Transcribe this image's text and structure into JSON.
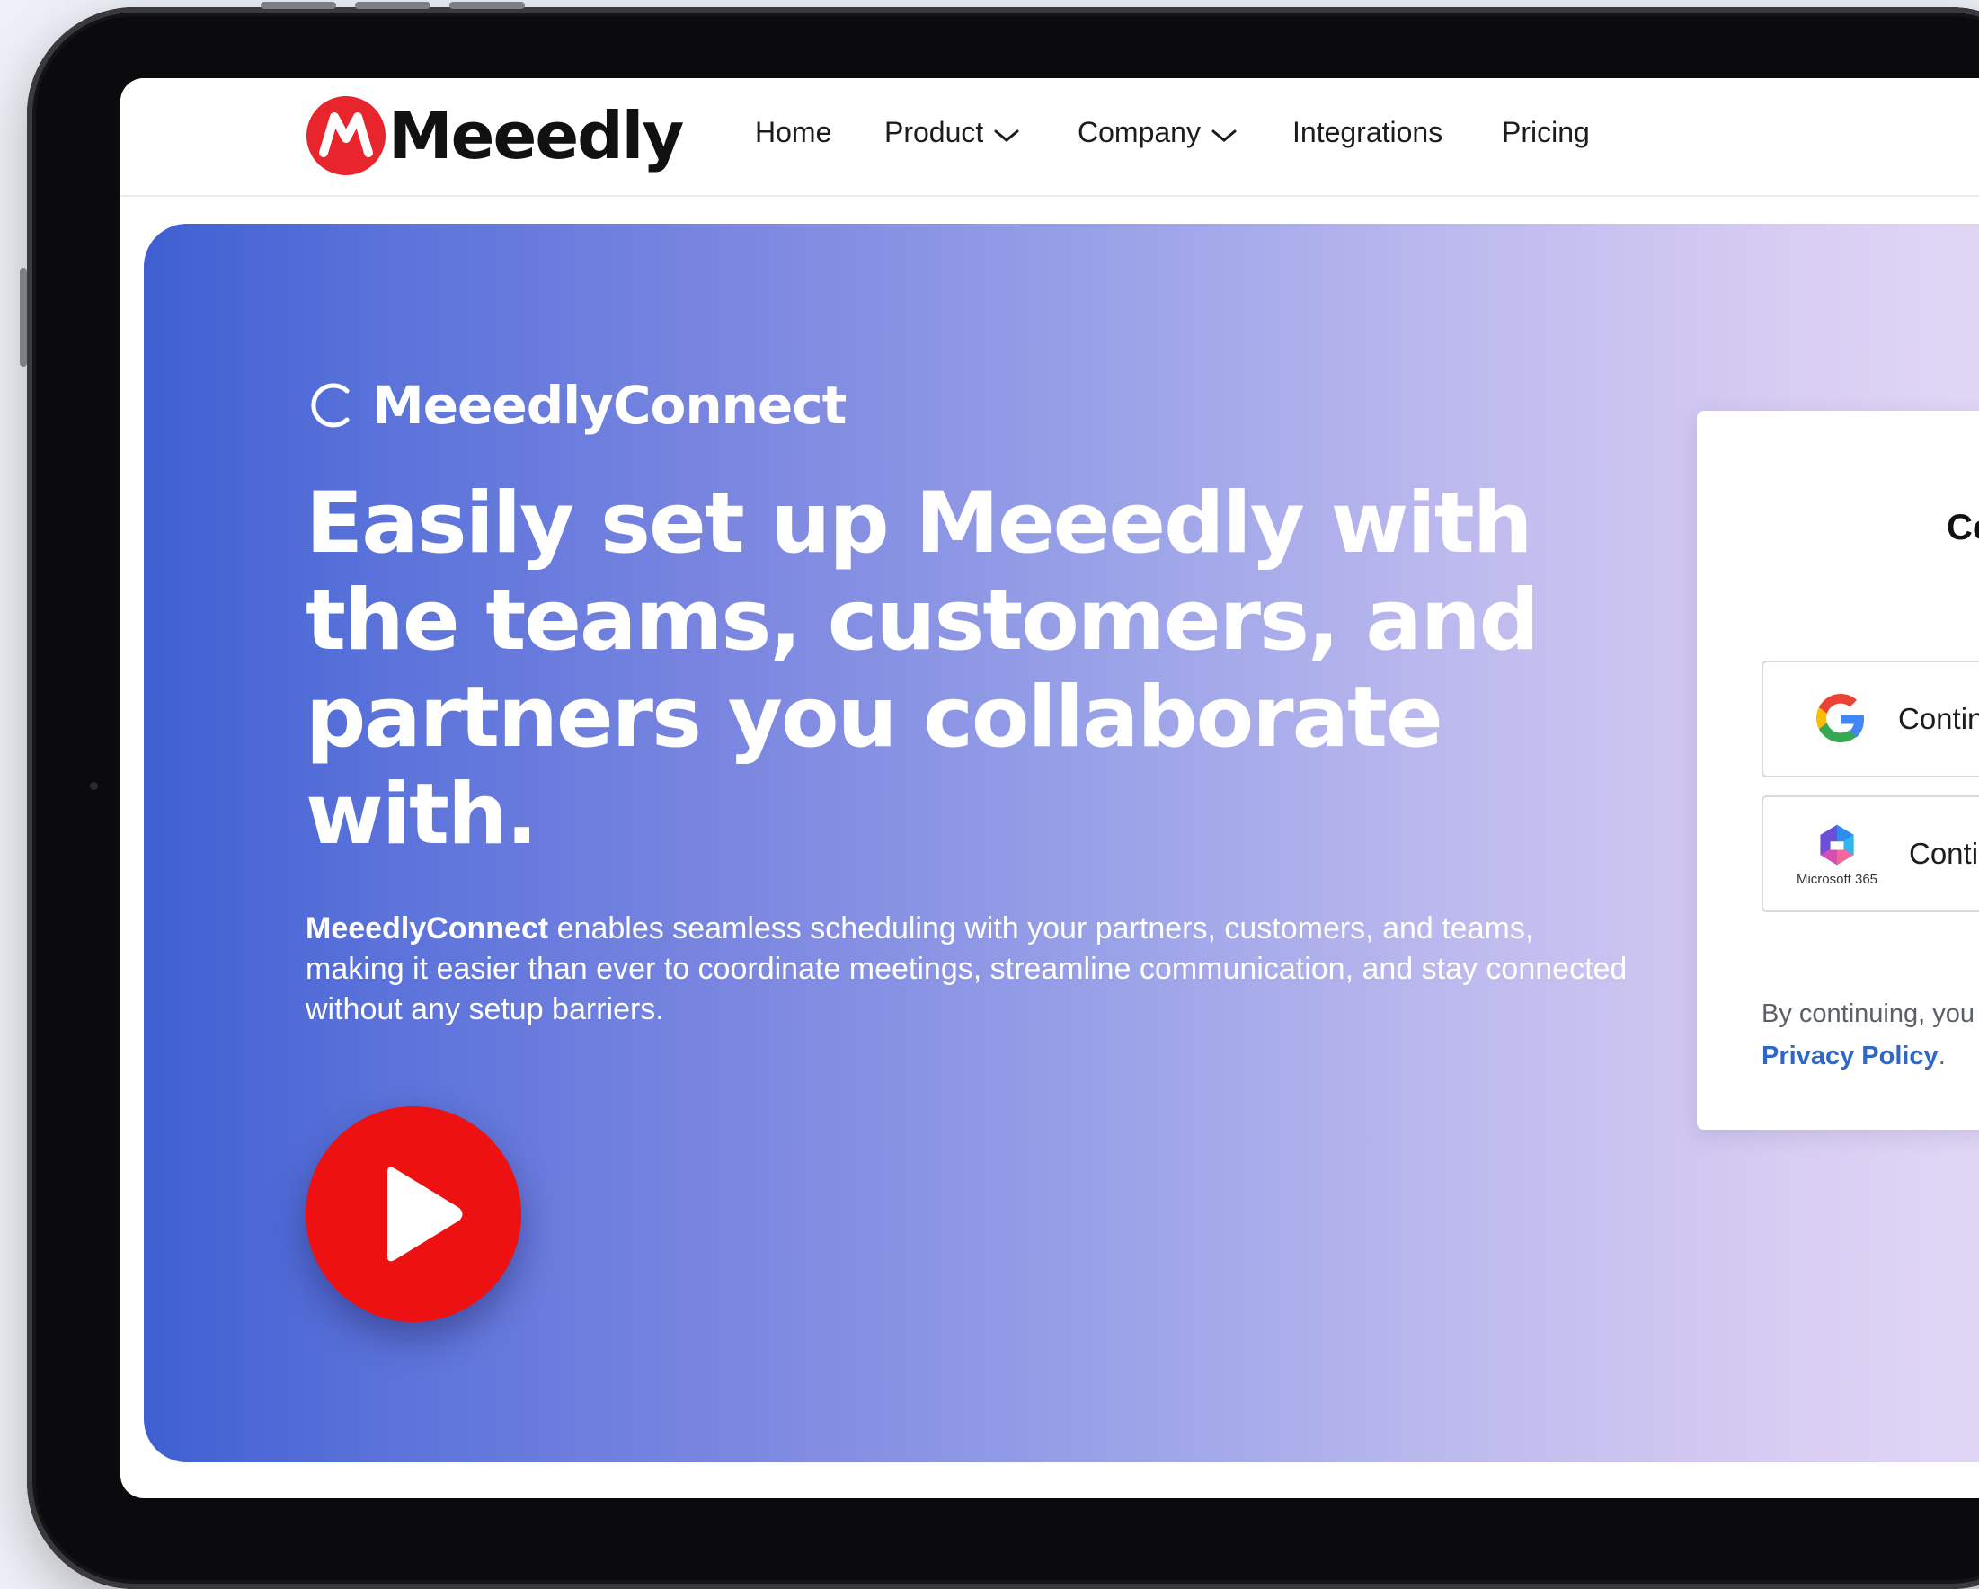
{
  "header": {
    "logo_text": "Meeedly",
    "nav": {
      "home": "Home",
      "product": "Product",
      "company": "Company",
      "integrations": "Integrations",
      "pricing": "Pricing"
    }
  },
  "hero": {
    "brand_name": "MeeedlyConnect",
    "headline": "Easily set up Meeedly with the teams, customers, and partners you collaborate with.",
    "description_bold": "MeeedlyConnect",
    "description_rest": " enables seamless scheduling with your partners, customers, and teams, making it easier than ever to coordinate meetings, streamline communication, and stay connected without any setup barriers."
  },
  "signin_card": {
    "title": "Cor",
    "google_label": "Continu",
    "microsoft_label": "Contin",
    "microsoft_caption": "Microsoft 365",
    "legal_text": "By continuing, you",
    "privacy_link": "Privacy Policy",
    "legal_end": "."
  },
  "icons": {
    "logo": "meeedly-logo-icon",
    "brand": "refresh-circle-icon",
    "chevron": "chevron-down-icon",
    "play": "play-icon",
    "google": "google-icon",
    "microsoft": "microsoft-365-icon"
  },
  "colors": {
    "brand_red": "#e8242c",
    "play_red": "#ee1111",
    "hero_gradient_start": "#3f5fd2",
    "hero_gradient_end": "#e5dcf6",
    "link_blue": "#2f67c8"
  }
}
